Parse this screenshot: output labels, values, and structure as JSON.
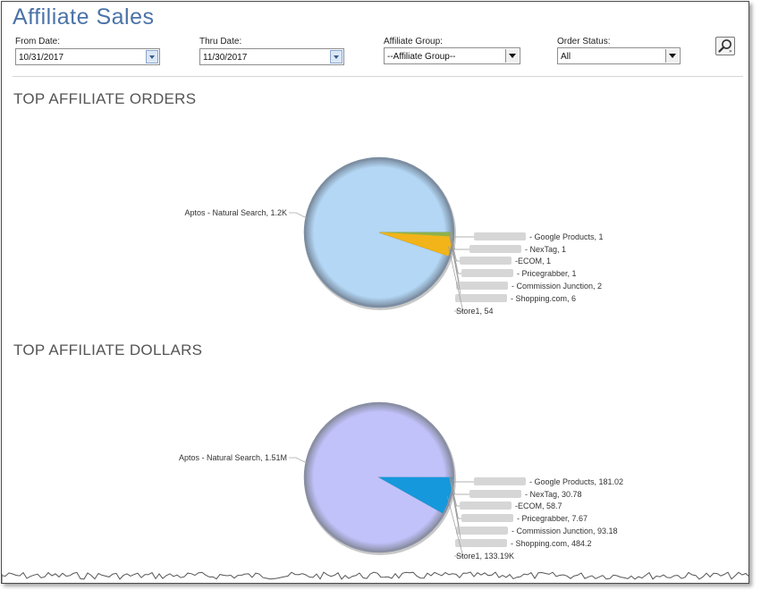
{
  "page": {
    "title": "Affiliate Sales"
  },
  "filters": {
    "from_date": {
      "label": "From Date:",
      "value": "10/31/2017"
    },
    "thru_date": {
      "label": "Thru Date:",
      "value": "11/30/2017"
    },
    "affiliate_group": {
      "label": "Affiliate Group:",
      "value": "--Affiliate Group--"
    },
    "order_status": {
      "label": "Order Status:",
      "value": "All"
    }
  },
  "icons": {
    "search": "magnifier-icon",
    "calendar": "calendar-dropdown-icon",
    "dropdown": "chevron-down-icon"
  },
  "sections": {
    "orders_title": "TOP AFFILIATE ORDERS",
    "dollars_title": "TOP AFFILIATE DOLLARS"
  },
  "chart_data": [
    {
      "type": "pie",
      "title": "TOP AFFILIATE ORDERS",
      "colors": {
        "main": "#b3d7f5",
        "accent": "#f2b418",
        "thin": "#8fb24a",
        "rim": "#7c8ea2"
      },
      "slices": [
        {
          "label": "Aptos - Natural Search, 1.2K",
          "value": 1200
        },
        {
          "label": "- Google Products, 1",
          "value": 1
        },
        {
          "label": "- NexTag, 1",
          "value": 1
        },
        {
          "label": "-ECOM, 1",
          "value": 1
        },
        {
          "label": "- Pricegrabber, 1",
          "value": 1
        },
        {
          "label": "- Commission Junction, 2",
          "value": 2
        },
        {
          "label": "- Shopping.com, 6",
          "value": 6
        },
        {
          "label": "Store1, 54",
          "value": 54
        }
      ]
    },
    {
      "type": "pie",
      "title": "TOP AFFILIATE DOLLARS",
      "colors": {
        "main": "#c2c2fb",
        "accent": "#1598dc",
        "thin": "#6aa3c8",
        "rim": "#8a8fa5"
      },
      "slices": [
        {
          "label": "Aptos - Natural Search, 1.51M",
          "value": 1510000
        },
        {
          "label": "- Google Products, 181.02",
          "value": 181.02
        },
        {
          "label": "- NexTag, 30.78",
          "value": 30.78
        },
        {
          "label": "-ECOM, 58.7",
          "value": 58.7
        },
        {
          "label": "- Pricegrabber, 7.67",
          "value": 7.67
        },
        {
          "label": "- Commission Junction, 93.18",
          "value": 93.18
        },
        {
          "label": "- Shopping.com, 484.2",
          "value": 484.2
        },
        {
          "label": "Store1, 133.19K",
          "value": 133190
        }
      ]
    }
  ]
}
